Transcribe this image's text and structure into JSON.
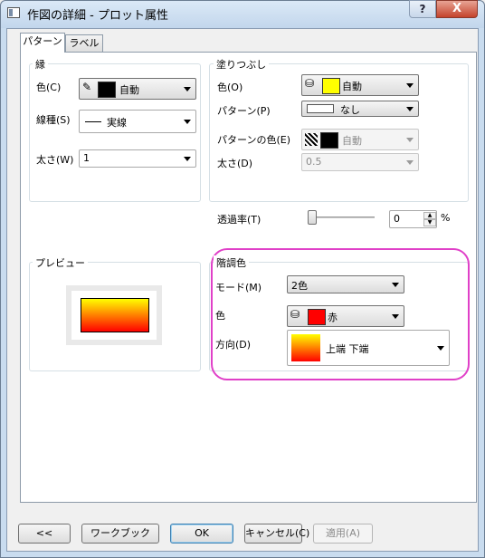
{
  "window": {
    "title": "作図の詳細 - プロット属性",
    "help_label": "?",
    "close_label": "X"
  },
  "tabs": [
    {
      "label": "パターン",
      "active": true
    },
    {
      "label": "ラベル",
      "active": false
    }
  ],
  "border_group": {
    "title": "縁",
    "color_label": "色(C)",
    "color_value": "自動",
    "color_swatch": "#000000",
    "linetype_label": "線種(S)",
    "linetype_value": "実線",
    "width_label": "太さ(W)",
    "width_value": "1"
  },
  "fill_group": {
    "title": "塗りつぶし",
    "color_label": "色(O)",
    "color_value": "自動",
    "color_swatch": "#ffff00",
    "pattern_label": "パターン(P)",
    "pattern_value": "なし",
    "pattern_color_label": "パターンの色(E)",
    "pattern_color_value": "自動",
    "width_label": "太さ(D)",
    "width_value": "0.5"
  },
  "transparency": {
    "label": "透過率(T)",
    "value": "0",
    "unit": "%",
    "level_percent": 0
  },
  "preview": {
    "title": "プレビュー",
    "gradient_top": "#ffff00",
    "gradient_bottom": "#ff0000"
  },
  "gradient_group": {
    "title": "階調色",
    "mode_label": "モード(M)",
    "mode_value": "2色",
    "color_label": "色",
    "color_value": "赤",
    "color_swatch": "#ff0000",
    "direction_label": "方向(D)",
    "direction_value": "上端 下端"
  },
  "footer": {
    "back_label": "<<",
    "workbook_label": "ワークブック",
    "ok_label": "OK",
    "cancel_label": "キャンセル(C)",
    "apply_label": "適用(A)"
  },
  "colors": {
    "highlight_ring": "#e040c8",
    "panel_border": "#8d9aa8"
  }
}
